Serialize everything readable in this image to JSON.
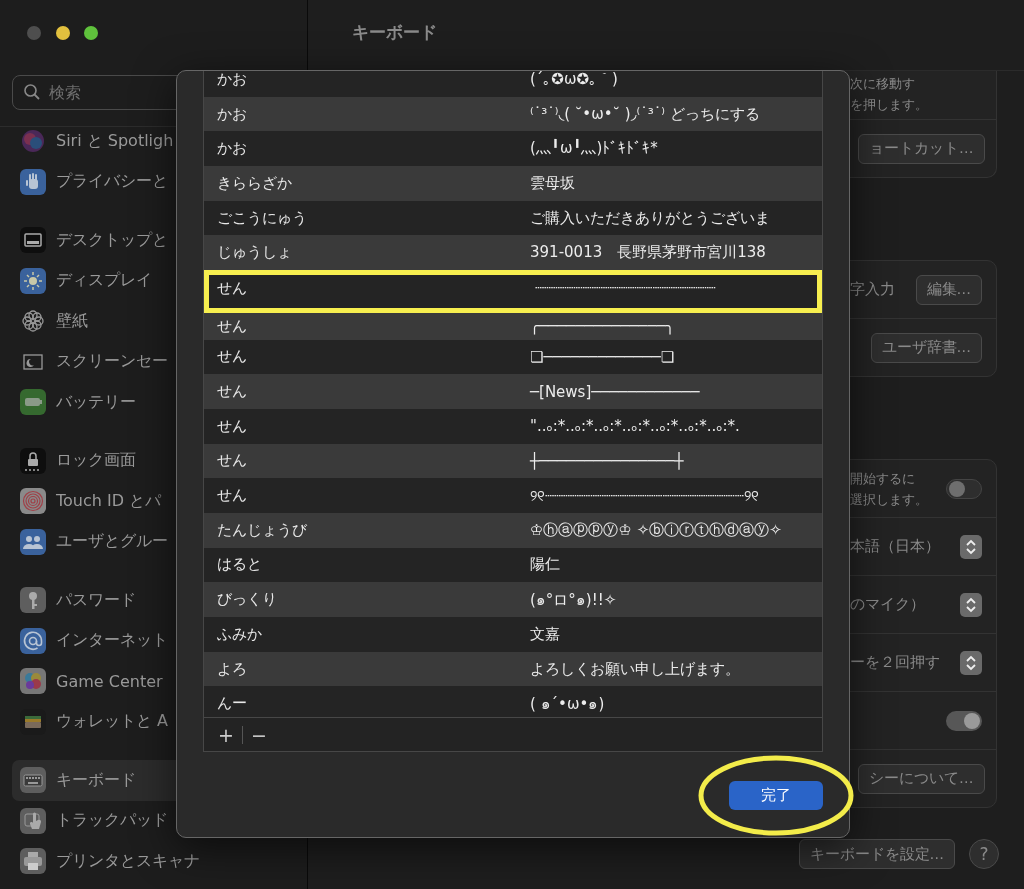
{
  "sidebar": {
    "search": {
      "placeholder": "検索"
    },
    "groups": [
      {
        "items": [
          {
            "label": "Siri と Spotligh",
            "selected": false
          },
          {
            "label": "プライバシーと",
            "selected": false
          }
        ]
      },
      {
        "items": [
          {
            "label": "デスクトップと",
            "selected": false
          },
          {
            "label": "ディスプレイ",
            "selected": false
          },
          {
            "label": "壁紙",
            "selected": false
          },
          {
            "label": "スクリーンセー",
            "selected": false
          },
          {
            "label": "バッテリー",
            "selected": false
          }
        ]
      },
      {
        "items": [
          {
            "label": "ロック画面",
            "selected": false
          },
          {
            "label": "Touch ID とパ",
            "selected": false
          },
          {
            "label": "ユーザとグルー",
            "selected": false
          }
        ]
      },
      {
        "items": [
          {
            "label": "パスワード",
            "selected": false
          },
          {
            "label": "インターネット",
            "selected": false
          },
          {
            "label": "Game Center",
            "selected": false
          },
          {
            "label": "ウォレットと A",
            "selected": false
          }
        ]
      },
      {
        "items": [
          {
            "label": "キーボード",
            "selected": true
          },
          {
            "label": "トラックパッド",
            "selected": false
          },
          {
            "label": "プリンタとスキャナ",
            "selected": false
          }
        ]
      }
    ]
  },
  "pane": {
    "title": "キーボード",
    "cards": [
      {
        "rows": [
          {
            "kind": "note",
            "lines": [
              "次に移動す",
              "を押します。"
            ]
          },
          {
            "kind": "button",
            "button": "ョートカット…"
          }
        ]
      },
      {
        "rows": [
          {
            "kind": "button",
            "label": "字入力",
            "button": "編集…"
          },
          {
            "kind": "button",
            "button": "ユーザ辞書…"
          }
        ]
      },
      {
        "rows": [
          {
            "kind": "toggle",
            "lines": [
              "開始するに",
              "選択します。"
            ],
            "on": false
          },
          {
            "kind": "popup",
            "label": "本語（日本）"
          },
          {
            "kind": "popup",
            "label": "のマイク）"
          },
          {
            "kind": "popup",
            "label": "ーを２回押す"
          },
          {
            "kind": "toggle",
            "on": true
          },
          {
            "kind": "button",
            "button": "シーについて…"
          }
        ]
      }
    ],
    "footer": {
      "setup_button": "キーボードを設定…",
      "help_button": "?"
    }
  },
  "dialog": {
    "rows": [
      {
        "reading": "かお",
        "word": "(´｡✪ω✪｡｀)",
        "annotated": false
      },
      {
        "reading": "かお",
        "word": "⁽˙³˙⁾◟( ˘•ω•˘ )◞⁽˙³˙⁾ どっちにする",
        "annotated": false
      },
      {
        "reading": "かお",
        "word": "(灬╹ω╹灬)ﾄﾞｷﾄﾞｷ*",
        "annotated": false
      },
      {
        "reading": "きららざか",
        "word": "雲母坂",
        "annotated": false
      },
      {
        "reading": "ごこうにゅう",
        "word": "ご購入いただきありがとうございま",
        "annotated": false
      },
      {
        "reading": "じゅうしょ",
        "word": "391-0013　長野県茅野市宮川138",
        "annotated": false
      },
      {
        "reading": "せん",
        "word": "┈┈┈┈┈┈┈┈┈┈┈┈┈┈┈┈┈┈┈┈",
        "annotated": true
      },
      {
        "reading": "せん",
        "word": "╭──────────────╮",
        "annotated": false
      },
      {
        "reading": "せん",
        "word": "❏─────────────❏",
        "annotated": false
      },
      {
        "reading": "せん",
        "word": "─[News]────────────",
        "annotated": false
      },
      {
        "reading": "せん",
        "word": "\"..ₒ:*..ₒ:*..ₒ:*..ₒ:*..ₒ:*..ₒ:*..ₒ:*.",
        "annotated": false
      },
      {
        "reading": "せん",
        "word": "┼───────────────┼",
        "annotated": false
      },
      {
        "reading": "せん",
        "word": "୨୧┈┈┈┈┈┈┈┈┈┈┈┈┈┈┈┈┈┈┈┈┈┈୨୧",
        "annotated": false
      },
      {
        "reading": "たんじょうび",
        "word": "♔ⓗⓐⓟⓟⓨ♔ ✧ⓑⓘⓡⓣⓗⓓⓐⓨ✧",
        "annotated": false
      },
      {
        "reading": "はると",
        "word": "陽仁",
        "annotated": false
      },
      {
        "reading": "びっくり",
        "word": "(๑°ロ°๑)!!✧",
        "annotated": false
      },
      {
        "reading": "ふみか",
        "word": "文嘉",
        "annotated": false
      },
      {
        "reading": "よろ",
        "word": "よろしくお願い申し上げます。",
        "annotated": false
      },
      {
        "reading": "んー",
        "word": "( ๑´•ω•๑)",
        "annotated": false
      }
    ],
    "add": "+",
    "remove": "−",
    "done_button": {
      "label": "完了",
      "annotated": true
    }
  }
}
